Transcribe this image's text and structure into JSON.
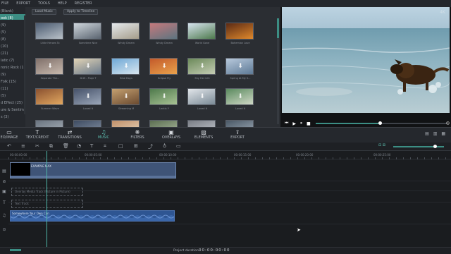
{
  "menubar": {
    "items": [
      "FILE",
      "EXPORT",
      "TOOLS",
      "HELP",
      "REGISTER"
    ]
  },
  "categories": {
    "items": [
      "(Blank)",
      "ook (8)",
      "(9)",
      "(5)",
      "(8)",
      "(10)",
      "(21)",
      "latic (7)",
      "ronic Rock (15)",
      "(9)",
      "Folk (15)",
      "(11)",
      "(5)",
      "d Effect (25)",
      "ure & Sentime...",
      "s (3)"
    ]
  },
  "library": {
    "load_music_label": "Load Music",
    "apply_label": "Apply to Timeline",
    "thumbnails": [
      {
        "caption": "Little Heroes To",
        "c1": "#4a5a70",
        "c2": "#b9c1c8",
        "dl": false
      },
      {
        "caption": "Sometime Nice",
        "c1": "#cfd6dc",
        "c2": "#5a6470",
        "dl": false
      },
      {
        "caption": "Windy Dream",
        "c1": "#e4e8ec",
        "c2": "#a59d8b",
        "dl": false
      },
      {
        "caption": "Windy Dream",
        "c1": "#c5797c",
        "c2": "#5d7480",
        "dl": false
      },
      {
        "caption": "World Gone",
        "c1": "#d6e3ee",
        "c2": "#4e7a4d",
        "dl": false
      },
      {
        "caption": "Bohemian Love",
        "c1": "#5a2a14",
        "c2": "#e0892c",
        "dl": false
      },
      {
        "caption": "Separate The...",
        "c1": "#80706a",
        "c2": "#c7b9ae",
        "dl": true
      },
      {
        "caption": "Drift - Proje T",
        "c1": "#e2d4b6",
        "c2": "#6a7a8c",
        "dl": true
      },
      {
        "caption": "Blue Days",
        "c1": "#6ea8d6",
        "c2": "#d8e6ef",
        "dl": true
      },
      {
        "caption": "Eclipse Fly",
        "c1": "#c35a2a",
        "c2": "#e9a24c",
        "dl": true
      },
      {
        "caption": "Shy Her Life",
        "c1": "#6c8a5a",
        "c2": "#c4ccb4",
        "dl": true
      },
      {
        "caption": "Spring At My S...",
        "c1": "#b8c9dc",
        "c2": "#5e7a96",
        "dl": true
      },
      {
        "caption": "Summer Wave",
        "c1": "#8a5130",
        "c2": "#e2a860",
        "dl": false
      },
      {
        "caption": "Loved It",
        "c1": "#46526a",
        "c2": "#9aa6b8",
        "dl": true
      },
      {
        "caption": "Streaming M",
        "c1": "#c4a070",
        "c2": "#6a4a30",
        "dl": true
      },
      {
        "caption": "Lentis Y",
        "c1": "#4f7a4c",
        "c2": "#a8c294",
        "dl": true
      },
      {
        "caption": "Loved It",
        "c1": "#e2e6ea",
        "c2": "#7a8a96",
        "dl": true
      },
      {
        "caption": "Loved It",
        "c1": "#5a8a5e",
        "c2": "#cfd8c6",
        "dl": true
      },
      {
        "caption": "",
        "c1": "#6a7480",
        "c2": "#aeb6be",
        "dl": false
      },
      {
        "caption": "",
        "c1": "#3e4c62",
        "c2": "#8a96a8",
        "dl": false
      },
      {
        "caption": "",
        "c1": "#c0906a",
        "c2": "#e8d8c0",
        "dl": false
      },
      {
        "caption": "",
        "c1": "#5c6f52",
        "c2": "#b0bea4",
        "dl": false
      },
      {
        "caption": "",
        "c1": "#7a7e86",
        "c2": "#c8ccd2",
        "dl": false
      },
      {
        "caption": "",
        "c1": "#4a5866",
        "c2": "#a6b2be",
        "dl": false
      }
    ]
  },
  "preview": {
    "watermark": "4K",
    "progress": 0.49,
    "controls": [
      "prev-frame",
      "play",
      "pause",
      "stop"
    ]
  },
  "tabs": {
    "items": [
      {
        "label": "EO/IMAGE",
        "icon": "folder-icon",
        "glyph": "▭"
      },
      {
        "label": "TEXT/CREDIT",
        "icon": "text-icon",
        "glyph": "T"
      },
      {
        "label": "TRANSITIONS",
        "icon": "transition-icon",
        "glyph": "⇄"
      },
      {
        "label": "MUSIC",
        "icon": "music-icon",
        "glyph": "♫",
        "active": true
      },
      {
        "label": "FILTERS",
        "icon": "filter-icon",
        "glyph": "❋"
      },
      {
        "label": "OVERLAYS",
        "icon": "overlay-icon",
        "glyph": "▣"
      },
      {
        "label": "ELEMENTS",
        "icon": "image-icon",
        "glyph": "▨"
      },
      {
        "label": "EXPORT",
        "icon": "export-icon",
        "glyph": "⇪"
      }
    ],
    "right_glyphs": "▤ ▥ ▦"
  },
  "toolbar": {
    "tools": [
      {
        "name": "undo-icon",
        "glyph": "↶"
      },
      {
        "name": "adjust-icon",
        "glyph": "≡"
      },
      {
        "name": "cut-icon",
        "glyph": "✂"
      },
      {
        "name": "split-icon",
        "glyph": "⧉"
      },
      {
        "name": "delete-icon",
        "glyph": "🗑"
      },
      {
        "name": "speed-icon",
        "glyph": "◔"
      },
      {
        "name": "text-tool-icon",
        "glyph": "T"
      },
      {
        "name": "crop-icon",
        "glyph": "⌗"
      },
      {
        "name": "rectangle-icon",
        "glyph": "□"
      },
      {
        "name": "mosaic-icon",
        "glyph": "⊞"
      },
      {
        "name": "detach-icon",
        "glyph": "⤴"
      },
      {
        "name": "mic-icon",
        "glyph": "♁"
      },
      {
        "name": "record-icon",
        "glyph": "▭"
      }
    ],
    "zoom_level": 0.82
  },
  "ruler": {
    "timecodes": [
      "00:00:00:00",
      "00:00:05:00",
      "00:00:10:00",
      "00:00:15:00",
      "00:00:20:00",
      "00:00:25:00"
    ]
  },
  "tracks": {
    "video_clip_label": "EXAMPLE MAX",
    "overlay_placeholder": "Overlay Media Track (Picture in Picture)",
    "text_placeholder": "Text Track",
    "audio_clip_label": "Somewhere Your Own Con"
  },
  "status": {
    "label": "Project duration:",
    "value": "00:00:00:00"
  }
}
